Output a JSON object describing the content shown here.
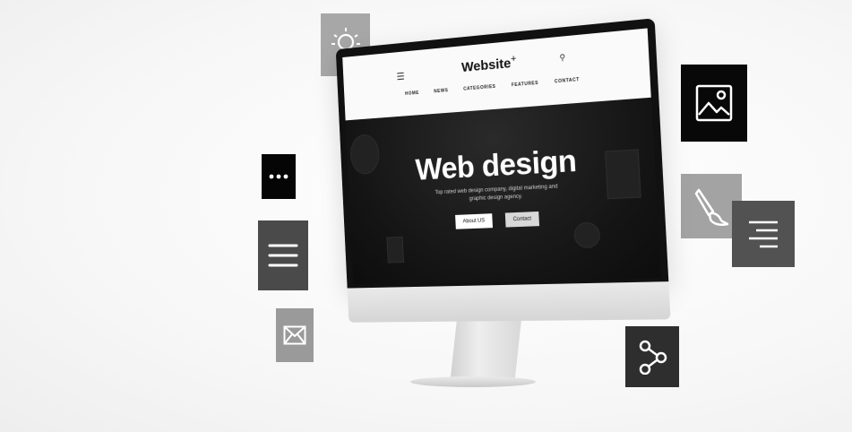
{
  "website": {
    "brand": "Website",
    "brand_plus": "+",
    "nav": [
      "HOME",
      "NEWS",
      "CATEGORIES",
      "FEATURES",
      "CONTACT"
    ]
  },
  "hero": {
    "title": "Web design",
    "subtitle": "Top rated web design company, digital marketing and graphic design agency.",
    "about_button": "About US",
    "contact_button": "Contact"
  },
  "icons": [
    "lightbulb-icon",
    "more-dots-icon",
    "text-lines-icon",
    "mail-icon",
    "image-icon",
    "paint-brush-icon",
    "text-align-icon",
    "share-icon"
  ]
}
